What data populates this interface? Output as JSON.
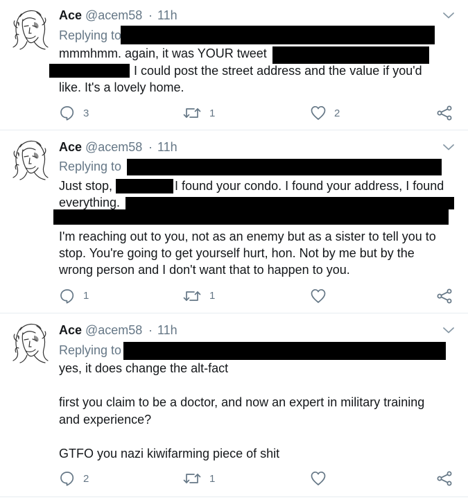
{
  "tweets": [
    {
      "name": "Ace",
      "handle": "@acem58",
      "dot": "·",
      "time": "11h",
      "replying": "Replying to",
      "lines": [
        "mmmhmm. again, it was YOUR tweet",
        "I could post the street address and the value if you'd",
        "like. It's a lovely home."
      ],
      "reply_count": "3",
      "retweet_count": "1",
      "like_count": "2"
    },
    {
      "name": "Ace",
      "handle": "@acem58",
      "dot": "·",
      "time": "11h",
      "replying": "Replying to",
      "lines": [
        "Just stop,",
        "I found your condo. I found your address, I found",
        "everything.",
        "I'm reaching out to you, not as an enemy but as a sister to tell you to",
        "stop. You're going to get yourself hurt, hon. Not by me but by the",
        "wrong person and I don't want that to happen to you."
      ],
      "reply_count": "1",
      "retweet_count": "1",
      "like_count": ""
    },
    {
      "name": "Ace",
      "handle": "@acem58",
      "dot": "·",
      "time": "11h",
      "replying": "Replying to",
      "lines": [
        "yes, it does change the alt-fact",
        "first you claim to be a doctor, and now an expert in military training",
        "and experience?",
        "GTFO you nazi kiwifarming piece of shit"
      ],
      "reply_count": "2",
      "retweet_count": "1",
      "like_count": ""
    }
  ],
  "icons": {
    "reply": "reply-icon",
    "retweet": "retweet-icon",
    "like": "heart-icon",
    "share": "share-icon",
    "menu": "chevron-down-icon"
  },
  "colors": {
    "muted": "#657786",
    "text": "#14171a",
    "divider": "#e6ecf0",
    "redaction": "#000000"
  }
}
